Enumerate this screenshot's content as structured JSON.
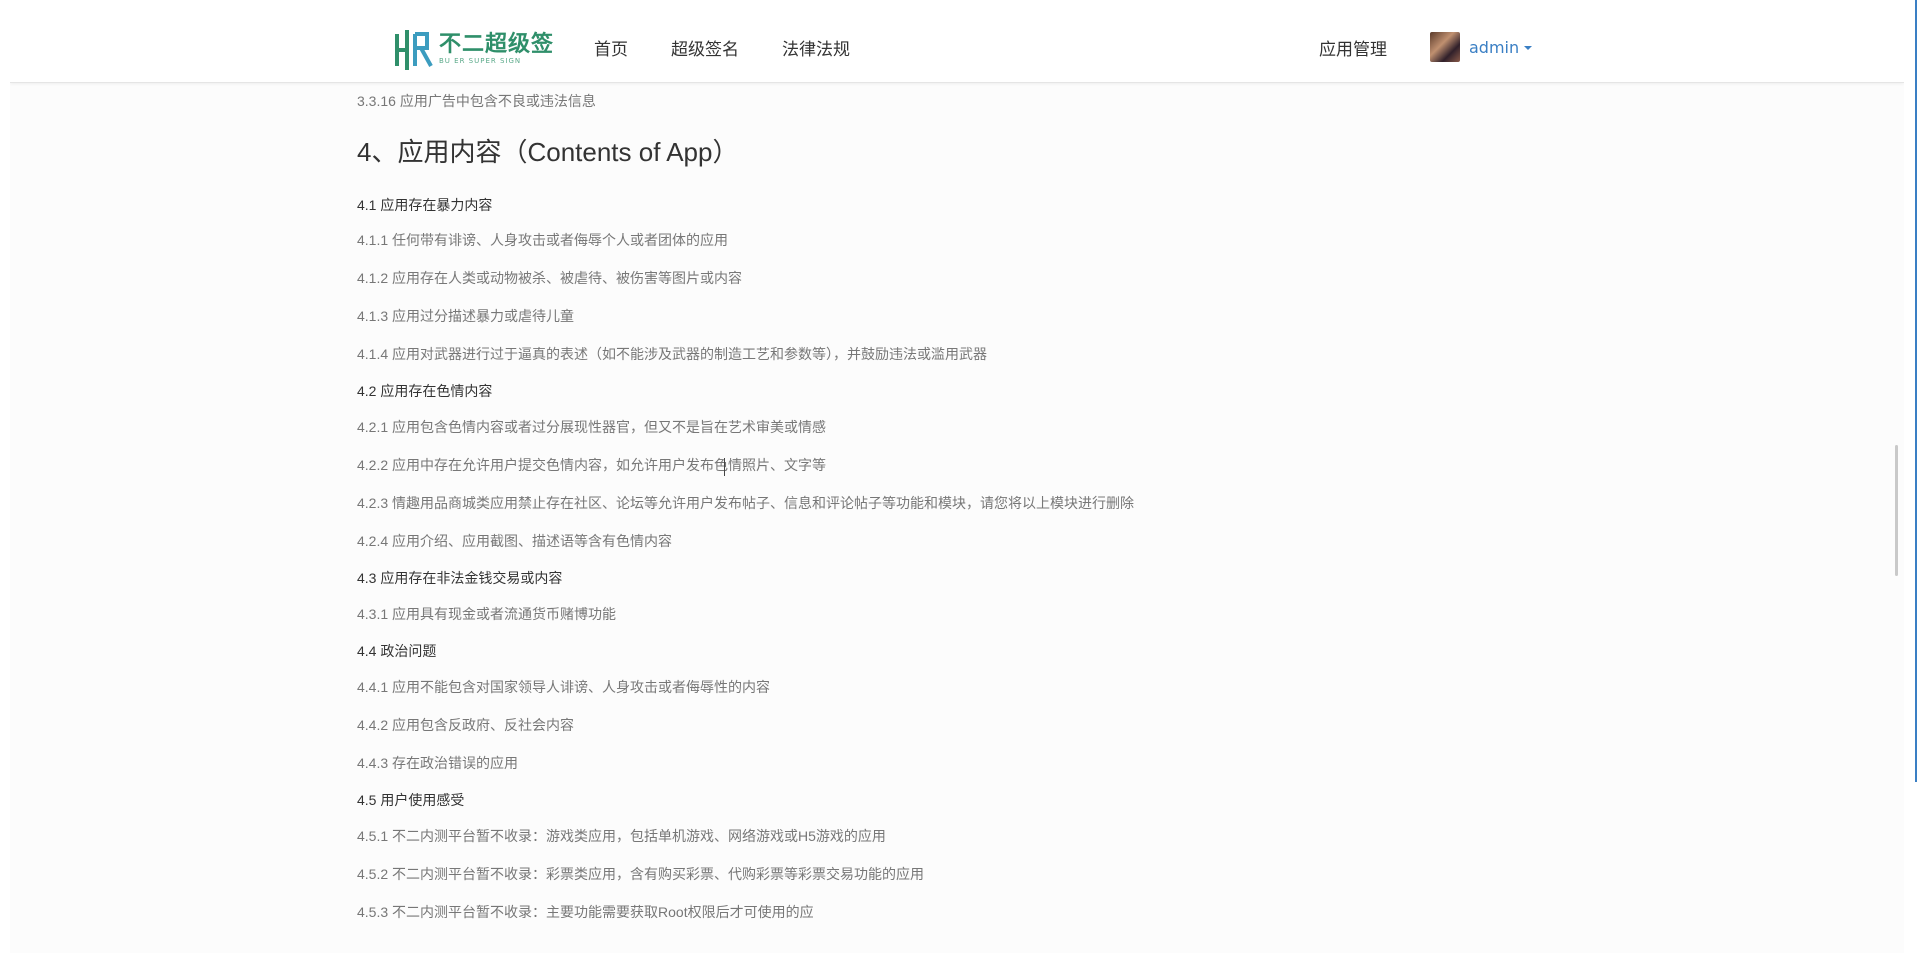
{
  "header": {
    "logo_main": "不二超级签",
    "logo_sub": "BU ER SUPER SIGN",
    "nav_left": [
      "首页",
      "超级签名",
      "法律法规"
    ],
    "nav_right": "应用管理",
    "user_name": "admin"
  },
  "content": {
    "prev_item": "3.3.16 应用广告中包含不良或违法信息",
    "heading": "4、应用内容（Contents of App）",
    "sections": [
      {
        "type": "sub",
        "text": "4.1 应用存在暴力内容"
      },
      {
        "type": "item",
        "text": "4.1.1 任何带有诽谤、人身攻击或者侮辱个人或者团体的应用"
      },
      {
        "type": "item",
        "text": "4.1.2 应用存在人类或动物被杀、被虐待、被伤害等图片或内容"
      },
      {
        "type": "item",
        "text": "4.1.3 应用过分描述暴力或虐待儿童"
      },
      {
        "type": "item",
        "text": "4.1.4 应用对武器进行过于逼真的表述（如不能涉及武器的制造工艺和参数等），并鼓励违法或滥用武器"
      },
      {
        "type": "sub",
        "text": "4.2 应用存在色情内容"
      },
      {
        "type": "item",
        "text": "4.2.1 应用包含色情内容或者过分展现性器官，但又不是旨在艺术审美或情感"
      },
      {
        "type": "item",
        "text": "4.2.2 应用中存在允许用户提交色情内容，如允许用户发布色情照片、文字等"
      },
      {
        "type": "item",
        "text": "4.2.3 情趣用品商城类应用禁止存在社区、论坛等允许用户发布帖子、信息和评论帖子等功能和模块，请您将以上模块进行删除"
      },
      {
        "type": "item",
        "text": "4.2.4 应用介绍、应用截图、描述语等含有色情内容"
      },
      {
        "type": "sub",
        "text": "4.3 应用存在非法金钱交易或内容"
      },
      {
        "type": "item",
        "text": "4.3.1 应用具有现金或者流通货币赌博功能"
      },
      {
        "type": "sub",
        "text": "4.4 政治问题"
      },
      {
        "type": "item",
        "text": "4.4.1 应用不能包含对国家领导人诽谤、人身攻击或者侮辱性的内容"
      },
      {
        "type": "item",
        "text": "4.4.2 应用包含反政府、反社会内容"
      },
      {
        "type": "item",
        "text": "4.4.3 存在政治错误的应用"
      },
      {
        "type": "sub",
        "text": "4.5 用户使用感受"
      },
      {
        "type": "item",
        "text": "4.5.1 不二内测平台暂不收录：游戏类应用，包括单机游戏、网络游戏或H5游戏的应用"
      },
      {
        "type": "item",
        "text": "4.5.2 不二内测平台暂不收录：彩票类应用，含有购买彩票、代购彩票等彩票交易功能的应用"
      },
      {
        "type": "item",
        "text": "4.5.3 不二内测平台暂不收录：主要功能需要获取Root权限后才可使用的应"
      }
    ]
  },
  "colors": {
    "accent": "#3a7fc4",
    "brand": "#2f8f6a",
    "body_text": "#777777",
    "heading_text": "#333333"
  }
}
